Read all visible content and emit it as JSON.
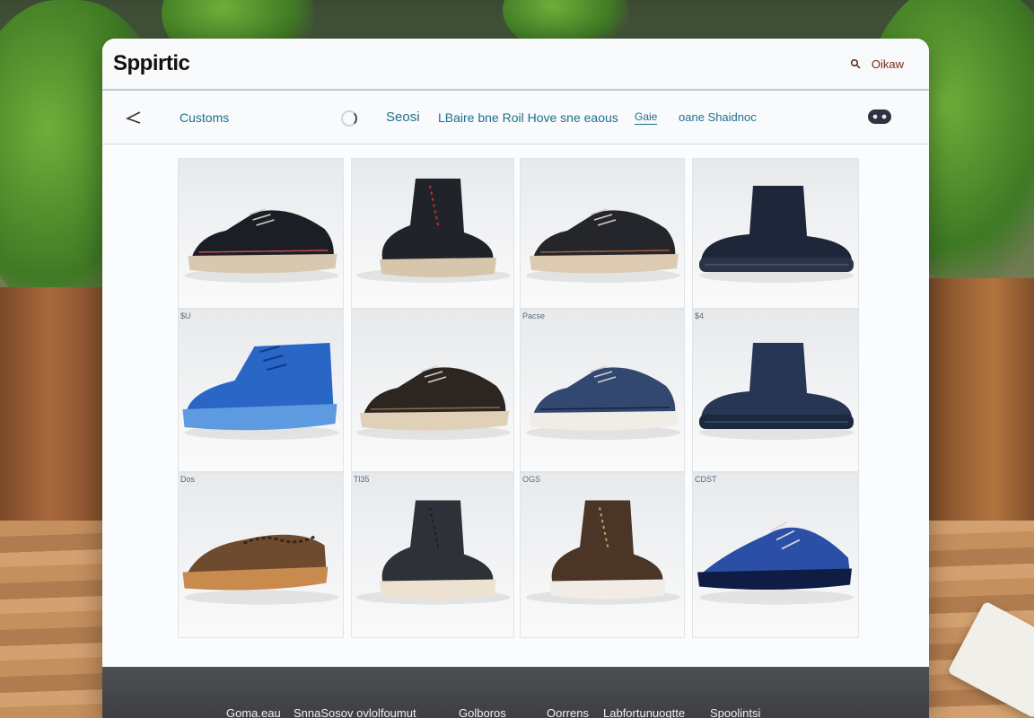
{
  "app": {
    "logo": "Sppirtic"
  },
  "account": {
    "label": "Oikaw"
  },
  "nav": {
    "customs": "Customs",
    "search": "Seosi",
    "promo": "LBaire bne Roil Hove sne eaous",
    "small": "Gaie",
    "shop": "oane Shaidnoc"
  },
  "products": [
    {
      "tag": "",
      "name": "black-derby-shoe",
      "upper": "#1b1e24",
      "sole": "#d8c8b0",
      "accent": "#c24a4a"
    },
    {
      "tag": "",
      "name": "black-lace-up-boot",
      "upper": "#202329",
      "sole": "#d6c6ac",
      "accent": "#c23030"
    },
    {
      "tag": "",
      "name": "black-oxford-shoe",
      "upper": "#24262b",
      "sole": "#dccbb2",
      "accent": "#9b5f3a"
    },
    {
      "tag": "",
      "name": "navy-ankle-bootie",
      "upper": "#1e2739",
      "sole": "#2a3348",
      "accent": "#4a5470"
    },
    {
      "tag": "$U",
      "name": "blue-high-top-sneaker",
      "upper": "#2a66c6",
      "sole": "#5d9ae0",
      "accent": "#0f3a8a"
    },
    {
      "tag": "",
      "name": "brown-derby-shoe",
      "upper": "#2c2520",
      "sole": "#e0d0b8",
      "accent": "#8a6a4a"
    },
    {
      "tag": "Pacse",
      "name": "navy-slip-on-sneaker",
      "upper": "#334870",
      "sole": "#f0ece6",
      "accent": "#16243e"
    },
    {
      "tag": "$4",
      "name": "navy-knit-bootie",
      "upper": "#263654",
      "sole": "#1c2840",
      "accent": "#3a4c72"
    },
    {
      "tag": "Dos",
      "name": "brown-woven-loafer",
      "upper": "#6e4a2e",
      "sole": "#c98a4e",
      "accent": "#3a2516"
    },
    {
      "tag": "Tl35",
      "name": "charcoal-chelsea-boot",
      "upper": "#2e3138",
      "sole": "#ede2d0",
      "accent": "#1a1c20"
    },
    {
      "tag": "OGS",
      "name": "brown-lace-boot",
      "upper": "#4a3526",
      "sole": "#f1ede6",
      "accent": "#c9a06a"
    },
    {
      "tag": "CDST",
      "name": "blue-clog",
      "upper": "#2b4fa6",
      "sole": "#1e3a80",
      "accent": "#0f1d44"
    }
  ],
  "footer": {
    "links": [
      "Goma.eau",
      "SnnaSosov ovlolfoumut",
      "Golboros",
      "Oorrens",
      "Labfortunuogtte",
      "Spoolintsi"
    ]
  },
  "colors": {
    "nav_text": "#1f6f8c",
    "footer_bg": "#3f4144"
  }
}
